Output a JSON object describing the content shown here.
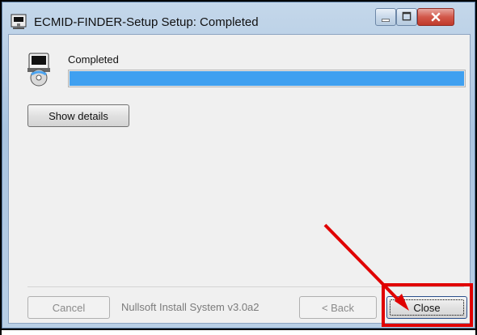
{
  "window": {
    "title": "ECMID-FINDER-Setup Setup: Completed"
  },
  "installer": {
    "status_label": "Completed",
    "progress_fraction": 1.0,
    "show_details_label": "Show details",
    "branding": "Nullsoft Install System v3.0a2",
    "cancel_label": "Cancel",
    "back_label": "< Back",
    "close_label": "Close"
  },
  "annotation": {
    "highlight_color": "#e00000"
  }
}
